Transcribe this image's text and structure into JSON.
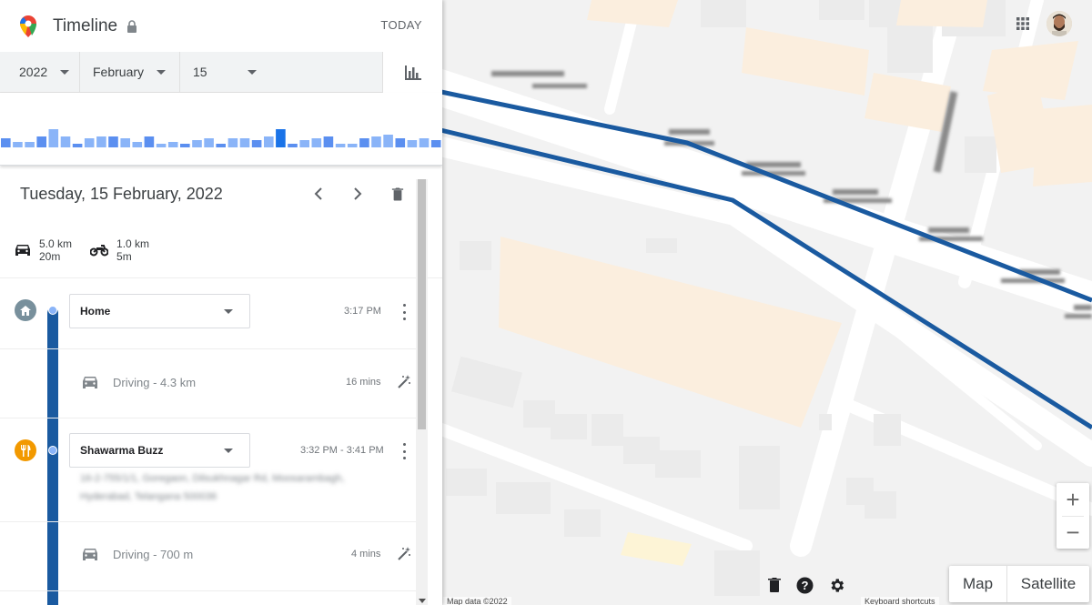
{
  "header": {
    "title": "Timeline",
    "today_label": "TODAY"
  },
  "date_selector": {
    "year": "2022",
    "month": "February",
    "day": "15"
  },
  "day": {
    "date_label": "Tuesday, 15 February, 2022"
  },
  "summary": [
    {
      "icon": "car-icon",
      "distance": "5.0 km",
      "duration": "20m"
    },
    {
      "icon": "motorcycle-icon",
      "distance": "1.0 km",
      "duration": "5m"
    }
  ],
  "timeline": {
    "places": [
      {
        "name": "Home",
        "time": "3:17 PM",
        "icon": "home-icon",
        "icon_color": "#78909c"
      },
      {
        "name": "Shawarma Buzz",
        "time": "3:32 PM - 3:41 PM",
        "icon": "restaurant-icon",
        "icon_color": "#f29900",
        "address": "16-2-755/1/1, Goregaon, Dilsukhnagar Rd, Moosarambagh, Hyderabad, Telangana 500036"
      }
    ],
    "drives": [
      {
        "mode": "Driving",
        "distance": "- 4.3 km",
        "duration": "16 mins"
      },
      {
        "mode": "Driving",
        "distance": "- 700 m",
        "duration": "4 mins"
      }
    ]
  },
  "map": {
    "route_color": "#1a5aa0",
    "zoom_in_label": "+",
    "zoom_out_label": "−",
    "map_type_map": "Map",
    "map_type_satellite": "Satellite",
    "attribution": "Map data ©2022",
    "shortcuts": "Keyboard shortcuts"
  },
  "colors": {
    "accent": "#1a73e8",
    "timeline_line": "#1a5aa0"
  }
}
